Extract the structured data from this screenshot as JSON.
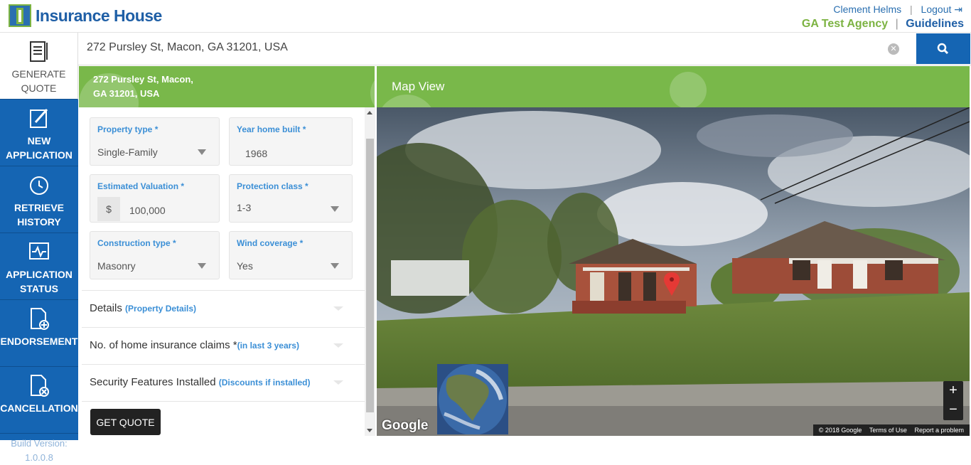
{
  "header": {
    "brand": "Insurance House",
    "user_name": "Clement Helms",
    "logout_label": "Logout",
    "agency": "GA Test Agency",
    "guidelines_label": "Guidelines"
  },
  "sidebar": {
    "items": [
      {
        "label_line1": "GENERATE",
        "label_line2": "QUOTE",
        "icon": "document-list-icon"
      },
      {
        "label_line1": "NEW",
        "label_line2": "APPLICATION",
        "icon": "pencil-edit-icon"
      },
      {
        "label_line1": "RETRIEVE",
        "label_line2": "HISTORY",
        "icon": "history-clock-icon"
      },
      {
        "label_line1": "APPLICATION",
        "label_line2": "STATUS",
        "icon": "status-monitor-icon"
      },
      {
        "label_line1": "ENDORSEMENT",
        "label_line2": "",
        "icon": "document-add-icon"
      },
      {
        "label_line1": "CANCELLATION",
        "label_line2": "",
        "icon": "document-cancel-icon"
      }
    ],
    "build_label": "Build Version:",
    "build_version": "1.0.0.8"
  },
  "search": {
    "value": "272 Pursley St, Macon, GA 31201, USA"
  },
  "address_banner": {
    "line1": "272 Pursley St, Macon,",
    "line2": "GA 31201, USA"
  },
  "map_banner": {
    "title": "Map View"
  },
  "form": {
    "property_type": {
      "label": "Property type *",
      "value": "Single-Family"
    },
    "year_built": {
      "label": "Year home built *",
      "value": "1968"
    },
    "valuation": {
      "label": "Estimated Valuation *",
      "currency": "$",
      "value": "100,000"
    },
    "protection_class": {
      "label": "Protection class *",
      "value": "1-3"
    },
    "construction_type": {
      "label": "Construction type *",
      "value": "Masonry"
    },
    "wind_coverage": {
      "label": "Wind coverage *",
      "value": "Yes"
    },
    "sections": [
      {
        "title": "Details",
        "sub": "(Property Details)"
      },
      {
        "title": "No. of home insurance claims *",
        "sub": "(in last 3 years)"
      },
      {
        "title": "Security Features Installed",
        "sub": "(Discounts if installed)"
      }
    ],
    "submit_label": "GET QUOTE"
  },
  "map": {
    "google_logo": "Google",
    "zoom_in": "+",
    "zoom_out": "−",
    "copyright": "© 2018 Google",
    "terms": "Terms of Use",
    "report": "Report a problem"
  },
  "colors": {
    "primary_blue": "#1565b3",
    "accent_green": "#79b84a",
    "label_blue": "#3b8fd6"
  }
}
